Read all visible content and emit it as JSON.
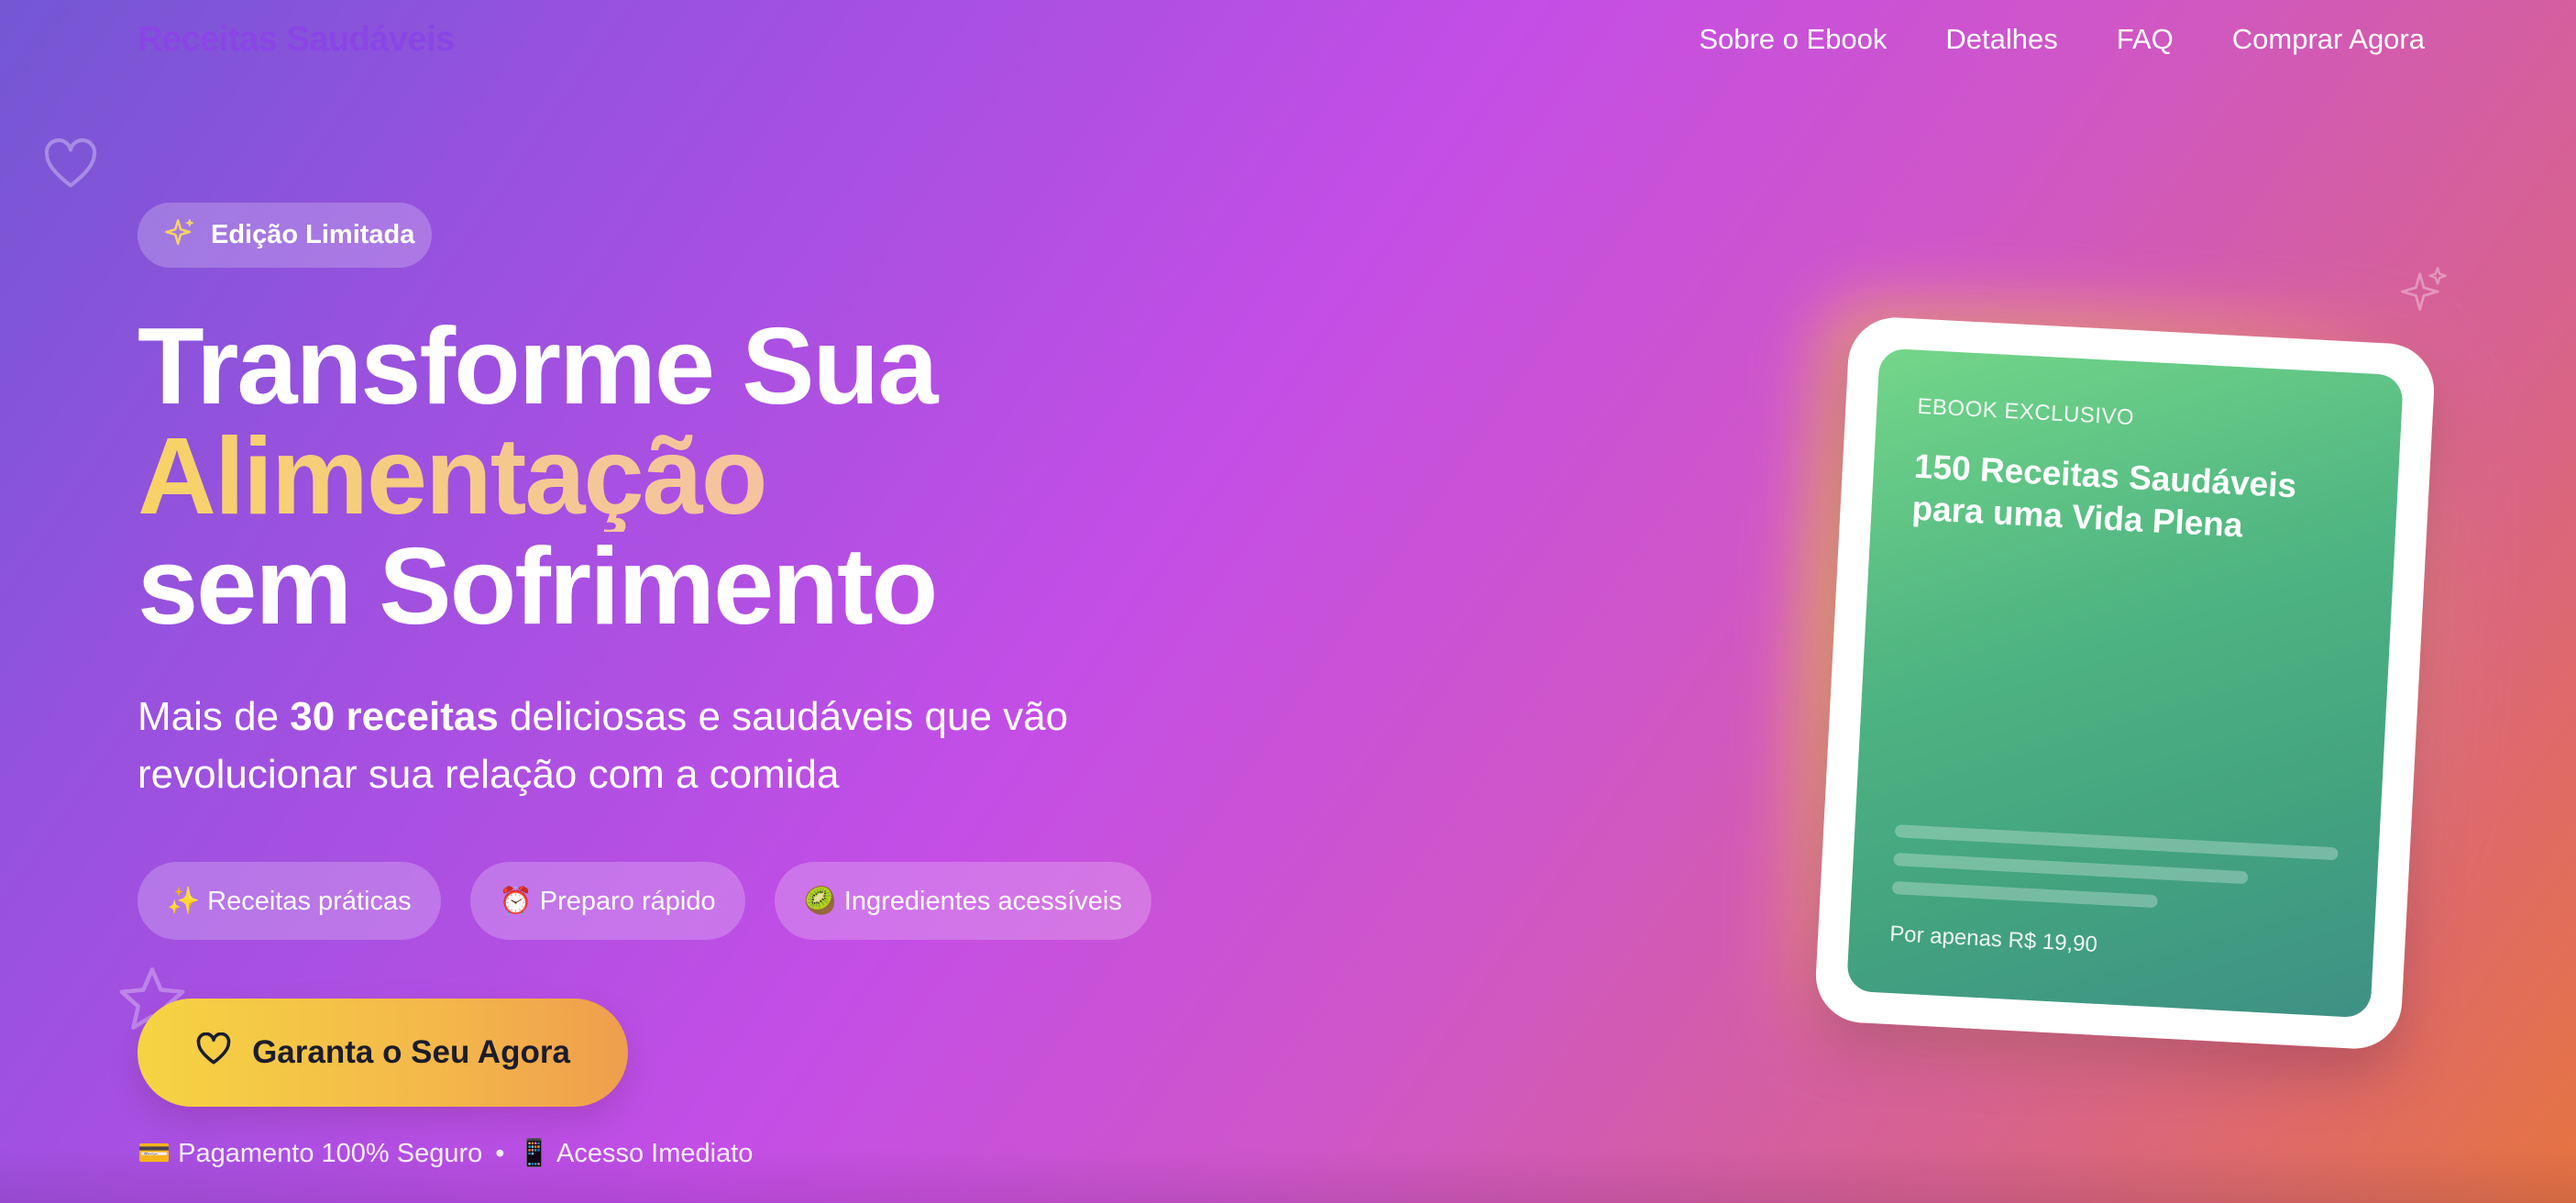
{
  "nav": {
    "logo": "Receitas Saudáveis",
    "links": [
      "Sobre o Ebook",
      "Detalhes",
      "FAQ",
      "Comprar Agora"
    ]
  },
  "hero": {
    "badge": "Edição Limitada",
    "headline": {
      "line1": "Transforme Sua",
      "line2": "Alimentação",
      "line3": "sem Sofrimento"
    },
    "subtitle": {
      "prefix": "Mais de ",
      "bold": "30 receitas",
      "suffix": " deliciosas e saudáveis que vão revolucionar sua relação com a comida"
    },
    "features": [
      "✨ Receitas práticas",
      "⏰ Preparo rápido",
      "🥝 Ingredientes acessíveis"
    ],
    "cta": "Garanta o Seu Agora",
    "trust": {
      "payment": "💳 Pagamento 100% Seguro",
      "separator": "•",
      "access": "📱 Acesso Imediato"
    }
  },
  "ebook": {
    "kicker": "EBOOK EXCLUSIVO",
    "title": "150 Receitas Saudáveis para uma Vida Plena",
    "price": "Por apenas R$ 19,90"
  },
  "icons": {
    "badge": "sparkles-icon",
    "cta": "heart-icon",
    "decorations": [
      "heart-outline-icon",
      "star-outline-icon",
      "sparkle-outline-icon"
    ]
  },
  "colors": {
    "logo": "#8a45e6",
    "accent_gold": "#f6d365",
    "cta_start": "#f5d442",
    "cta_end": "#ef9e4d",
    "book_green": "#4fb582"
  }
}
